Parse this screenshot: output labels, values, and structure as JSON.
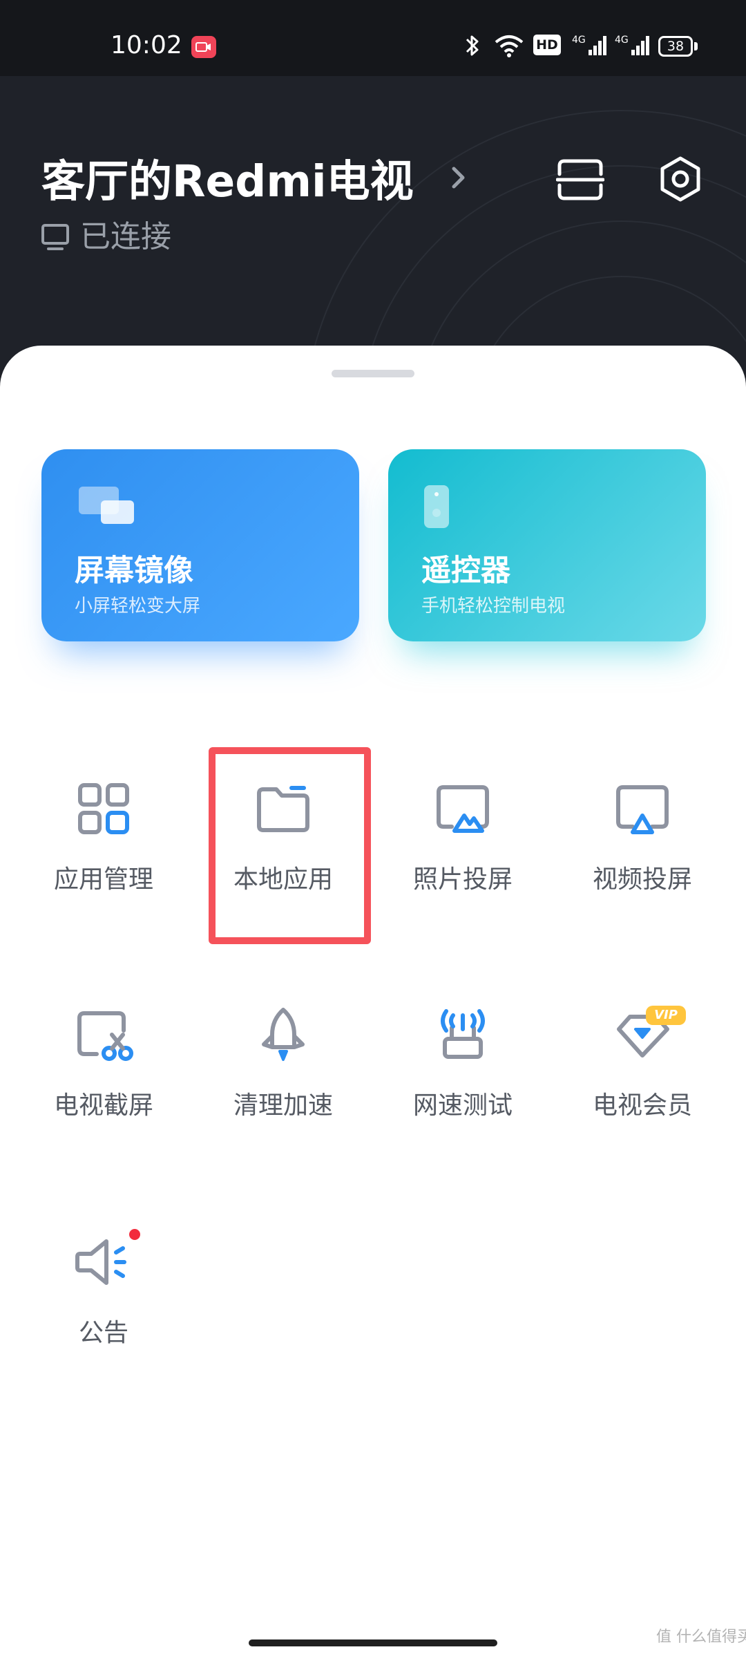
{
  "status_bar": {
    "time": "10:02",
    "hd_label": "HD",
    "network_1": "4G",
    "network_2": "4G",
    "battery": "38",
    "icons": [
      "screen-record-icon",
      "bluetooth-icon",
      "wifi-icon",
      "hd-icon",
      "signal-4g-icon",
      "signal-4g-icon",
      "battery-icon"
    ]
  },
  "header": {
    "device_name": "客厅的Redmi电视",
    "connection_status": "已连接",
    "icons": [
      "chevron-right-icon",
      "scan-icon",
      "settings-icon",
      "tv-icon"
    ]
  },
  "feature_cards": [
    {
      "title": "屏幕镜像",
      "subtitle": "小屏轻松变大屏",
      "icon": "screen-mirror-icon",
      "color": "#3a9cf6"
    },
    {
      "title": "遥控器",
      "subtitle": "手机轻松控制电视",
      "icon": "remote-control-icon",
      "color": "#25c6d9"
    }
  ],
  "tools": [
    {
      "label": "应用管理",
      "icon": "app-grid-icon"
    },
    {
      "label": "本地应用",
      "icon": "folder-icon",
      "highlighted": true
    },
    {
      "label": "照片投屏",
      "icon": "photo-cast-icon"
    },
    {
      "label": "视频投屏",
      "icon": "video-cast-icon"
    },
    {
      "label": "电视截屏",
      "icon": "screenshot-scissors-icon"
    },
    {
      "label": "清理加速",
      "icon": "rocket-icon"
    },
    {
      "label": "网速测试",
      "icon": "router-icon"
    },
    {
      "label": "电视会员",
      "icon": "diamond-vip-icon",
      "badge": "VIP"
    },
    {
      "label": "公告",
      "icon": "speaker-icon",
      "has_notification_dot": true
    }
  ],
  "colors": {
    "header_bg": "#1f2229",
    "icon_gray": "#8e93a0",
    "icon_blue": "#2b8ef2",
    "highlight_red": "#f5525a",
    "vip_gold": "#ffc53d"
  },
  "watermark": "值 什么值得买"
}
